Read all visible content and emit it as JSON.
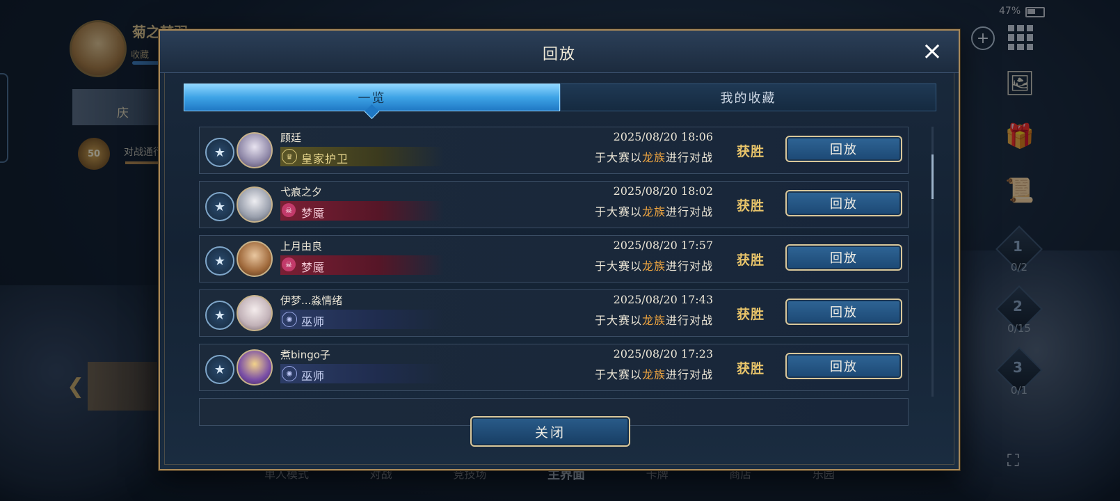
{
  "status": {
    "battery": "47%"
  },
  "profile": {
    "name": "菊之梦羽",
    "sub": "收藏",
    "level": "50",
    "week_label": "对战通行证"
  },
  "quest": {
    "label": "庆"
  },
  "ranks": [
    {
      "num": "1",
      "count": "0/2"
    },
    {
      "num": "2",
      "count": "0/15"
    },
    {
      "num": "3",
      "count": "0/1"
    }
  ],
  "bottom_nav": [
    "单人模式",
    "对战",
    "竞技场",
    "主界面",
    "卡牌",
    "商店",
    "乐园"
  ],
  "dialog": {
    "title": "回放",
    "close_icon": "×",
    "tabs": [
      {
        "label": "一览",
        "active": true
      },
      {
        "label": "我的收藏",
        "active": false
      }
    ],
    "close_button": "关闭",
    "colors": {
      "accent_gold": "#e8c46a",
      "highlight_orange": "#f0a640",
      "tab_active": "#3ea3e6"
    }
  },
  "matches": [
    {
      "player": "顾廷",
      "class": "皇家护卫",
      "class_icon": "crown-icon",
      "date": "2025/08/20  18:06",
      "desc_pre": "于大赛以",
      "desc_hl": "龙族",
      "desc_post": "进行对战",
      "result": "获胜",
      "button": "回放"
    },
    {
      "player": "弋痕之夕",
      "class": "梦魇",
      "class_icon": "skull-icon",
      "date": "2025/08/20  18:02",
      "desc_pre": "于大赛以",
      "desc_hl": "龙族",
      "desc_post": "进行对战",
      "result": "获胜",
      "button": "回放"
    },
    {
      "player": "上月由良",
      "class": "梦魇",
      "class_icon": "skull-icon",
      "date": "2025/08/20  17:57",
      "desc_pre": "于大赛以",
      "desc_hl": "龙族",
      "desc_post": "进行对战",
      "result": "获胜",
      "button": "回放"
    },
    {
      "player": "伊梦...淼情绪",
      "class": "巫师",
      "class_icon": "magic-circle-icon",
      "date": "2025/08/20  17:43",
      "desc_pre": "于大赛以",
      "desc_hl": "龙族",
      "desc_post": "进行对战",
      "result": "获胜",
      "button": "回放"
    },
    {
      "player": "煮bingo子",
      "class": "巫师",
      "class_icon": "magic-circle-icon",
      "date": "2025/08/20  17:23",
      "desc_pre": "于大赛以",
      "desc_hl": "龙族",
      "desc_post": "进行对战",
      "result": "获胜",
      "button": "回放"
    }
  ]
}
